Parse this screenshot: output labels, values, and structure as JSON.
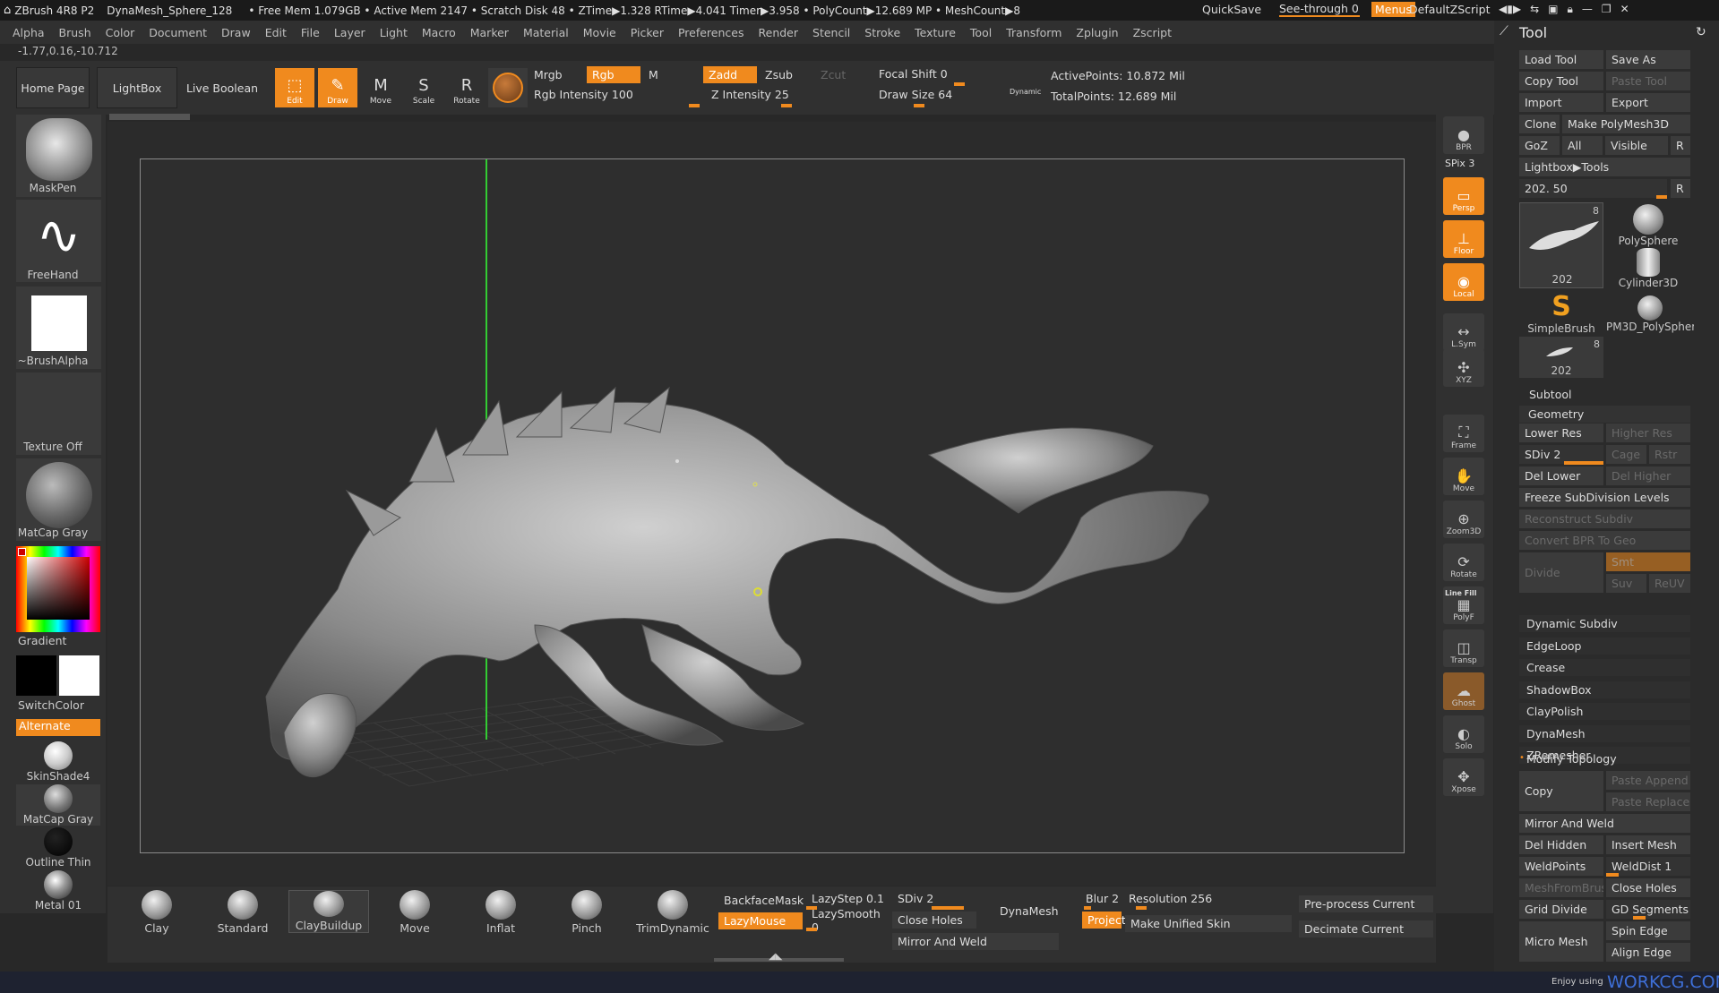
{
  "title_bar": {
    "app": "ZBrush 4R8 P2",
    "doc": "DynaMesh_Sphere_128",
    "stats": "• Free Mem 1.079GB • Active Mem 2147 • Scratch Disk 48 • ZTime▶1.328 RTime▶4.041 Timer▶3.958 • PolyCount▶12.689 MP • MeshCount▶8",
    "quicksave": "QuickSave",
    "see_through": "See-through  0",
    "menus": "Menus",
    "script": "DefaultZScript"
  },
  "menubar": [
    "Alpha",
    "Brush",
    "Color",
    "Document",
    "Draw",
    "Edit",
    "File",
    "Layer",
    "Light",
    "Macro",
    "Marker",
    "Material",
    "Movie",
    "Picker",
    "Preferences",
    "Render",
    "Stencil",
    "Stroke",
    "Texture",
    "Tool",
    "Transform",
    "Zplugin",
    "Zscript"
  ],
  "coords": "-1.77,0.16,-10.712",
  "shelf": {
    "home": "Home Page",
    "lightbox": "LightBox",
    "live_boolean": "Live Boolean",
    "tools": [
      {
        "label": "Edit",
        "icon": "edit-icon",
        "glyph": "⬚",
        "on": true
      },
      {
        "label": "Draw",
        "icon": "draw-icon",
        "glyph": "✎",
        "on": true
      },
      {
        "label": "Move",
        "icon": "move-icon",
        "glyph": "M",
        "on": false
      },
      {
        "label": "Scale",
        "icon": "scale-icon",
        "glyph": "S",
        "on": false
      },
      {
        "label": "Rotate",
        "icon": "rotate-icon",
        "glyph": "R",
        "on": false
      }
    ],
    "mrgb": "Mrgb",
    "rgb": "Rgb",
    "m": "M",
    "zadd": "Zadd",
    "zsub": "Zsub",
    "zcut": "Zcut",
    "rgb_intensity": "Rgb Intensity 100",
    "z_intensity": "Z Intensity 25",
    "focal_shift": "Focal Shift 0",
    "draw_size": "Draw Size 64",
    "dynamic": "Dynamic",
    "active_points": "ActivePoints: 10.872 Mil",
    "total_points": "TotalPoints: 12.689 Mil"
  },
  "left_tray": {
    "brush": "MaskPen",
    "stroke": "FreeHand",
    "alpha": "~BrushAlpha",
    "texture": "Texture Off",
    "material": "MatCap Gray",
    "gradient": "Gradient",
    "switch_color": "SwitchColor",
    "alternate": "Alternate",
    "materials": [
      "SkinShade4",
      "MatCap Gray",
      "Outline Thin",
      "Metal 01"
    ]
  },
  "right_bar": [
    {
      "label": "BPR",
      "icon": "bpr-icon",
      "on": false
    },
    {
      "label": "SPix 3",
      "icon": "",
      "on": false
    },
    {
      "label": "Persp",
      "icon": "persp-icon",
      "on": true
    },
    {
      "label": "Floor",
      "icon": "floor-icon",
      "on": true
    },
    {
      "label": "Local",
      "icon": "local-icon",
      "on": true
    },
    {
      "label": "L.Sym",
      "icon": "lsym-icon",
      "on": false
    },
    {
      "label": "XYZ",
      "icon": "xyz-icon",
      "on": false
    },
    {
      "label": "Frame",
      "icon": "frame-icon",
      "on": false
    },
    {
      "label": "Move",
      "icon": "move-icon",
      "on": false
    },
    {
      "label": "Zoom3D",
      "icon": "zoom-icon",
      "on": false
    },
    {
      "label": "Rotate",
      "icon": "rotate-icon",
      "on": false
    },
    {
      "label": "PolyF",
      "icon": "polyf-icon",
      "on": false
    },
    {
      "label": "Transp",
      "icon": "transp-icon",
      "on": false
    },
    {
      "label": "Ghost",
      "icon": "ghost-icon",
      "on": false
    },
    {
      "label": "Solo",
      "icon": "solo-icon",
      "on": false
    },
    {
      "label": "Xpose",
      "icon": "xpose-icon",
      "on": false
    }
  ],
  "line_fill": "Line Fill",
  "tool_panel": {
    "title": "Tool",
    "load_tool": "Load Tool",
    "save_as": "Save As",
    "copy_tool": "Copy Tool",
    "paste_tool": "Paste Tool",
    "import": "Import",
    "export": "Export",
    "clone": "Clone",
    "make_polymesh": "Make PolyMesh3D",
    "goz": "GoZ",
    "all": "All",
    "visible": "Visible",
    "r": "R",
    "lightbox_tools": "Lightbox▶Tools",
    "slider_value": "202. 50",
    "thumbs": [
      {
        "label": "202",
        "count": "8"
      },
      {
        "label": "PolySphere",
        "count": ""
      },
      {
        "label": "Cylinder3D",
        "count": ""
      },
      {
        "label": "SimpleBrush",
        "count": ""
      },
      {
        "label": "PM3D_PolySpher",
        "count": ""
      },
      {
        "label": "202",
        "count": "8"
      }
    ],
    "subtool": "Subtool",
    "geometry": "Geometry",
    "lower_res": "Lower Res",
    "higher_res": "Higher Res",
    "sdiv": "SDiv 2",
    "cage": "Cage",
    "rstr": "Rstr",
    "del_lower": "Del Lower",
    "del_higher": "Del Higher",
    "freeze": "Freeze SubDivision Levels",
    "reconstruct": "Reconstruct Subdiv",
    "convert_bpr": "Convert BPR To Geo",
    "divide": "Divide",
    "smt": "Smt",
    "suv": "Suv",
    "reuv": "ReUV",
    "sections": [
      "Dynamic Subdiv",
      "EdgeLoop",
      "Crease",
      "ShadowBox",
      "ClayPolish",
      "DynaMesh",
      "ZRemesher"
    ],
    "modify_topology": "Modify Topology",
    "copy": "Copy",
    "paste_append": "Paste Append",
    "paste_replace": "Paste Replace",
    "mirror_weld": "Mirror And Weld",
    "del_hidden": "Del Hidden",
    "insert_mesh": "Insert Mesh",
    "weld_points": "WeldPoints",
    "weld_dist": "WeldDist 1",
    "mesh_from_brush": "MeshFromBrush",
    "close_holes": "Close Holes",
    "grid_divide": "Grid Divide",
    "gd_segments": "GD Segments 3",
    "micro_mesh": "Micro Mesh",
    "spin_edge": "Spin Edge",
    "align_edge": "Align Edge"
  },
  "bottom_shelf": {
    "brushes": [
      "Clay",
      "Standard",
      "ClayBuildup",
      "Move",
      "Inflat",
      "Pinch",
      "TrimDynamic"
    ],
    "backface_mask": "BackfaceMask",
    "lazy_mouse": "LazyMouse",
    "lazy_step": "LazyStep 0.1",
    "lazy_smooth": "LazySmooth 0",
    "sdiv": "SDiv 2",
    "close_holes": "Close Holes",
    "mirror_weld": "Mirror And Weld",
    "dynamesh": "DynaMesh",
    "blur": "Blur 2",
    "resolution": "Resolution 256",
    "project": "Project",
    "make_unified": "Make Unified Skin",
    "preprocess": "Pre-process Current",
    "decimate": "Decimate Current"
  },
  "watermark_prefix": "Enjoy using",
  "watermark": "WORKCG.COM",
  "colors": {
    "accent": "#f08a1e",
    "panel": "#303030",
    "bg": "#282828"
  }
}
